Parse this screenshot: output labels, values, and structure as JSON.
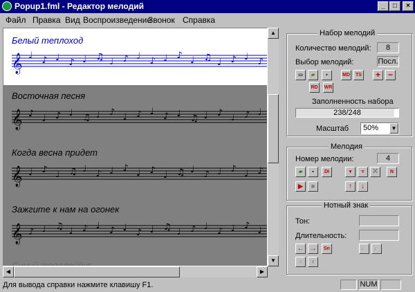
{
  "window": {
    "title": "Popup1.fml - Редактор мелодий"
  },
  "menu": {
    "items": [
      "Файл",
      "Правка",
      "Вид",
      "Воспроизведение",
      "Звонок",
      "Справка"
    ]
  },
  "melodies": [
    {
      "title": "Белый теплоход"
    },
    {
      "title": "Восточная песня"
    },
    {
      "title": "Когда весна придет"
    },
    {
      "title": "Зажгите к нам на огонек"
    },
    {
      "title": "Синий троллейбус"
    }
  ],
  "set_panel": {
    "title": "Набор мелодий",
    "count_label": "Количество мелодий:",
    "count_value": "8",
    "select_label": "Выбор мелодий:",
    "select_value": "Посл.",
    "buttons": [
      "new-icon",
      "open-icon",
      "save-icon",
      "MD",
      "TS",
      "+",
      "−",
      "RD",
      "WR"
    ],
    "fill_label": "Заполненность набора",
    "fill_value": "238/248",
    "fill_fraction": 0.96,
    "scale_label": "Масштаб",
    "scale_value": "50%"
  },
  "melody_panel": {
    "title": "Мелодия",
    "number_label": "Номер мелодии:",
    "number_value": "4",
    "buttons": [
      "open-icon",
      "save-icon",
      "DI",
      "insert-icon",
      "delete-icon",
      "cut-icon",
      "N",
      "play-icon",
      "stop-icon",
      "up-icon",
      "down-icon"
    ]
  },
  "note_panel": {
    "title": "Нотный знак",
    "tone_label": "Тон:",
    "tone_value": "",
    "duration_label": "Длительность:",
    "duration_value": "",
    "buttons": [
      "left-icon",
      "right-icon",
      "Sn"
    ]
  },
  "status": {
    "text": "Для вывода справки нажмите клавишу F1.",
    "num": "NUM"
  }
}
